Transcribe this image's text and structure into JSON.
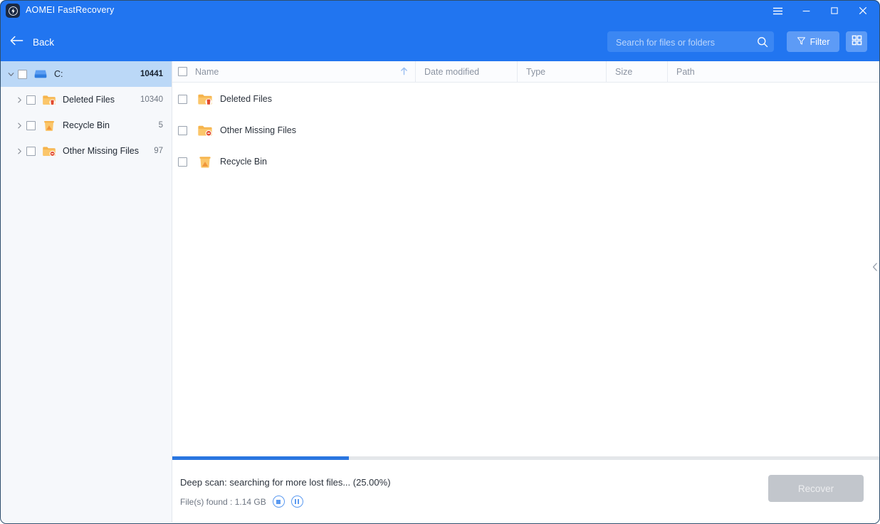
{
  "window": {
    "app_title": "AOMEI FastRecovery",
    "logo_icon": "lightning-bolt-icon",
    "controls": {
      "menu": "hamburger-menu-icon",
      "minimize": "minimize-icon",
      "maximize": "maximize-icon",
      "close": "close-icon"
    },
    "accent_color": "#2175f0"
  },
  "toolbar": {
    "back_label": "Back",
    "back_icon": "arrow-left-icon",
    "search": {
      "placeholder": "Search for files or folders",
      "value": "",
      "icon": "search-icon"
    },
    "filter_label": "Filter",
    "filter_icon": "funnel-icon",
    "grid_view_icon": "grid-view-icon"
  },
  "sidebar": {
    "items": [
      {
        "label": "C:",
        "count": "10441",
        "icon": "drive-icon",
        "selected": true,
        "expanded": true,
        "twisty": "chevron-down-icon",
        "indent": 0
      },
      {
        "label": "Deleted Files",
        "count": "10340",
        "icon": "folder-deleted-icon",
        "selected": false,
        "expanded": false,
        "twisty": "chevron-right-icon",
        "indent": 1
      },
      {
        "label": "Recycle Bin",
        "count": "5",
        "icon": "folder-recyclebin-icon",
        "selected": false,
        "expanded": false,
        "twisty": "chevron-right-icon",
        "indent": 1
      },
      {
        "label": "Other Missing Files",
        "count": "97",
        "icon": "folder-missing-icon",
        "selected": false,
        "expanded": false,
        "twisty": "chevron-right-icon",
        "indent": 1
      }
    ]
  },
  "file_list": {
    "columns": [
      {
        "label": "Name",
        "sort": "ascending",
        "sort_icon": "arrow-up-icon"
      },
      {
        "label": "Date modified"
      },
      {
        "label": "Type"
      },
      {
        "label": "Size"
      },
      {
        "label": "Path"
      }
    ],
    "rows": [
      {
        "name": "Deleted Files",
        "icon": "folder-deleted-icon",
        "date_modified": "",
        "type": "",
        "size": "",
        "path": "",
        "checked": false
      },
      {
        "name": "Other Missing Files",
        "icon": "folder-missing-icon",
        "date_modified": "",
        "type": "",
        "size": "",
        "path": "",
        "checked": false
      },
      {
        "name": "Recycle Bin",
        "icon": "folder-recyclebin-icon",
        "date_modified": "",
        "type": "",
        "size": "",
        "path": "",
        "checked": false
      }
    ],
    "collapse_icon": "chevron-left-icon"
  },
  "status": {
    "message": "Deep scan: searching for more lost files... (25.00%)",
    "files_found": "File(s) found : 1.14 GB",
    "progress_percent": 25,
    "stop_icon": "stop-circle-icon",
    "pause_icon": "pause-circle-icon",
    "recover_label": "Recover",
    "recover_enabled": false
  }
}
